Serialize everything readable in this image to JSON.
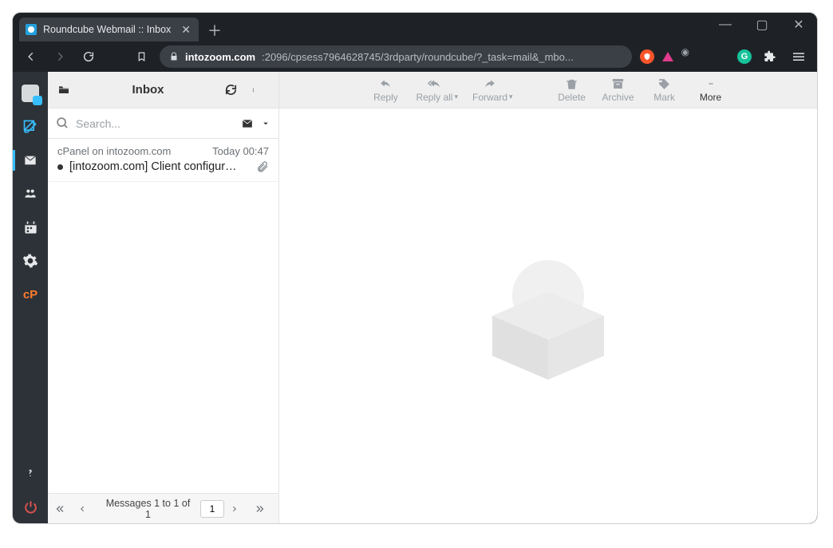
{
  "window": {
    "tab_title": "Roundcube Webmail :: Inbox",
    "url_domain": "intozoom.com",
    "url_rest": ":2096/cpsess7964628745/3rdparty/roundcube/?_task=mail&_mbo..."
  },
  "sidebar": {
    "items": [
      {
        "name": "logo"
      },
      {
        "name": "compose"
      },
      {
        "name": "mail"
      },
      {
        "name": "contacts"
      },
      {
        "name": "calendar"
      },
      {
        "name": "settings"
      },
      {
        "name": "cpanel",
        "label": "cP"
      }
    ]
  },
  "listpane": {
    "title": "Inbox",
    "search_placeholder": "Search...",
    "message": {
      "from": "cPanel on intozoom.com",
      "date": "Today 00:47",
      "subject": "[intozoom.com] Client configur…"
    },
    "footer": {
      "status": "Messages 1 to 1 of 1",
      "page": "1"
    }
  },
  "toolbar": {
    "reply": "Reply",
    "reply_all": "Reply all",
    "forward": "Forward",
    "delete": "Delete",
    "archive": "Archive",
    "mark": "Mark",
    "more": "More"
  }
}
